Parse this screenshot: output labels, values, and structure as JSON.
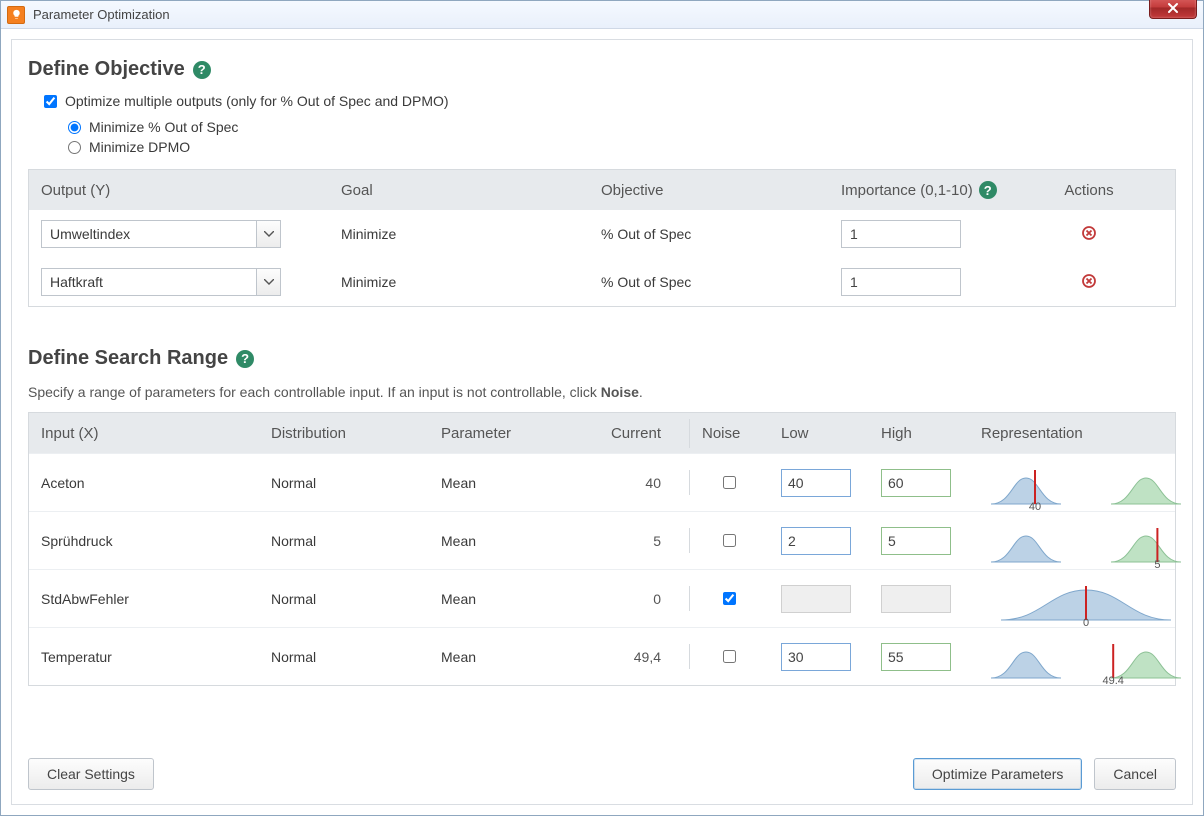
{
  "window": {
    "title": "Parameter Optimization"
  },
  "objective": {
    "heading": "Define Objective",
    "optimize_multiple_label": "Optimize multiple outputs (only for % Out of Spec and DPMO)",
    "optimize_multiple_checked": true,
    "radios": {
      "pct_out_label": "Minimize % Out of Spec",
      "dpmo_label": "Minimize DPMO",
      "selected": "pct_out"
    },
    "columns": {
      "output": "Output (Y)",
      "goal": "Goal",
      "objective": "Objective",
      "importance": "Importance (0,1-10)",
      "actions": "Actions"
    },
    "rows": [
      {
        "output": "Umweltindex",
        "goal": "Minimize",
        "objective": "% Out of Spec",
        "importance": "1"
      },
      {
        "output": "Haftkraft",
        "goal": "Minimize",
        "objective": "% Out of Spec",
        "importance": "1"
      }
    ]
  },
  "search": {
    "heading": "Define Search Range",
    "subtext_pre": "Specify a range of parameters for each controllable input. If an input is not controllable, click ",
    "subtext_bold": "Noise",
    "subtext_post": ".",
    "columns": {
      "input": "Input (X)",
      "distribution": "Distribution",
      "parameter": "Parameter",
      "current": "Current",
      "noise": "Noise",
      "low": "Low",
      "high": "High",
      "representation": "Representation"
    },
    "rows": [
      {
        "input": "Aceton",
        "distribution": "Normal",
        "parameter": "Mean",
        "current": "40",
        "noise": false,
        "low": "40",
        "high": "60",
        "marker_frac": 0.2,
        "marker_label": "40"
      },
      {
        "input": "Sprühdruck",
        "distribution": "Normal",
        "parameter": "Mean",
        "current": "5",
        "noise": false,
        "low": "2",
        "high": "5",
        "marker_frac": 0.92,
        "marker_label": "5"
      },
      {
        "input": "StdAbwFehler",
        "distribution": "Normal",
        "parameter": "Mean",
        "current": "0",
        "noise": true,
        "low": "",
        "high": "",
        "marker_frac": 0.5,
        "marker_label": "0",
        "single": true
      },
      {
        "input": "Temperatur",
        "distribution": "Normal",
        "parameter": "Mean",
        "current": "49,4",
        "noise": false,
        "low": "30",
        "high": "55",
        "marker_frac": 0.66,
        "marker_label": "49,4"
      }
    ]
  },
  "buttons": {
    "clear": "Clear Settings",
    "optimize": "Optimize Parameters",
    "cancel": "Cancel"
  }
}
